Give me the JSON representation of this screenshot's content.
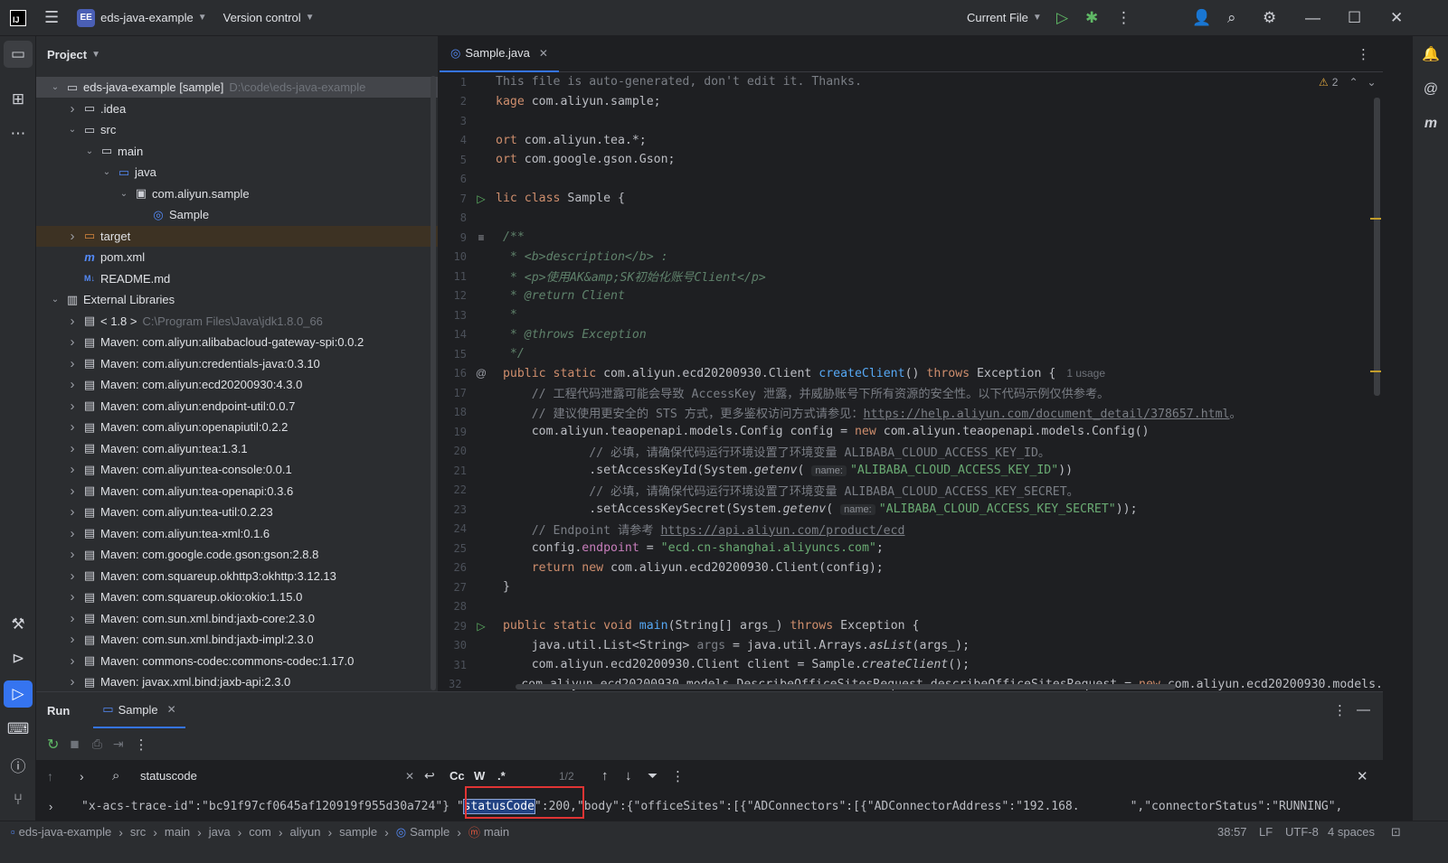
{
  "titlebar": {
    "project_badge": "EE",
    "project_name": "eds-java-example",
    "vcs": "Version control",
    "run_config": "Current File"
  },
  "project_panel": {
    "title": "Project",
    "tree": [
      {
        "indent": 0,
        "arrow": "down",
        "icon": "folder",
        "label": "eds-java-example [sample]",
        "path": "D:\\code\\eds-java-example",
        "selected": true
      },
      {
        "indent": 1,
        "arrow": "right",
        "icon": "folder",
        "label": ".idea"
      },
      {
        "indent": 1,
        "arrow": "down",
        "icon": "folder",
        "label": "src"
      },
      {
        "indent": 2,
        "arrow": "down",
        "icon": "folder",
        "label": "main"
      },
      {
        "indent": 3,
        "arrow": "down",
        "icon": "folder-blue",
        "label": "java"
      },
      {
        "indent": 4,
        "arrow": "down",
        "icon": "package",
        "label": "com.aliyun.sample"
      },
      {
        "indent": 5,
        "arrow": "none",
        "icon": "class",
        "label": "Sample"
      },
      {
        "indent": 1,
        "arrow": "right",
        "icon": "folder-orange",
        "label": "target",
        "highlight": true
      },
      {
        "indent": 1,
        "arrow": "none",
        "icon": "maven",
        "label": "pom.xml"
      },
      {
        "indent": 1,
        "arrow": "none",
        "icon": "markdown",
        "label": "README.md"
      },
      {
        "indent": 0,
        "arrow": "down",
        "icon": "library",
        "label": "External Libraries"
      },
      {
        "indent": 1,
        "arrow": "right",
        "icon": "lib",
        "label": "< 1.8 >",
        "path": "C:\\Program Files\\Java\\jdk1.8.0_66"
      },
      {
        "indent": 1,
        "arrow": "right",
        "icon": "lib",
        "label": "Maven: com.aliyun:alibabacloud-gateway-spi:0.0.2"
      },
      {
        "indent": 1,
        "arrow": "right",
        "icon": "lib",
        "label": "Maven: com.aliyun:credentials-java:0.3.10"
      },
      {
        "indent": 1,
        "arrow": "right",
        "icon": "lib",
        "label": "Maven: com.aliyun:ecd20200930:4.3.0"
      },
      {
        "indent": 1,
        "arrow": "right",
        "icon": "lib",
        "label": "Maven: com.aliyun:endpoint-util:0.0.7"
      },
      {
        "indent": 1,
        "arrow": "right",
        "icon": "lib",
        "label": "Maven: com.aliyun:openapiutil:0.2.2"
      },
      {
        "indent": 1,
        "arrow": "right",
        "icon": "lib",
        "label": "Maven: com.aliyun:tea:1.3.1"
      },
      {
        "indent": 1,
        "arrow": "right",
        "icon": "lib",
        "label": "Maven: com.aliyun:tea-console:0.0.1"
      },
      {
        "indent": 1,
        "arrow": "right",
        "icon": "lib",
        "label": "Maven: com.aliyun:tea-openapi:0.3.6"
      },
      {
        "indent": 1,
        "arrow": "right",
        "icon": "lib",
        "label": "Maven: com.aliyun:tea-util:0.2.23"
      },
      {
        "indent": 1,
        "arrow": "right",
        "icon": "lib",
        "label": "Maven: com.aliyun:tea-xml:0.1.6"
      },
      {
        "indent": 1,
        "arrow": "right",
        "icon": "lib",
        "label": "Maven: com.google.code.gson:gson:2.8.8"
      },
      {
        "indent": 1,
        "arrow": "right",
        "icon": "lib",
        "label": "Maven: com.squareup.okhttp3:okhttp:3.12.13"
      },
      {
        "indent": 1,
        "arrow": "right",
        "icon": "lib",
        "label": "Maven: com.squareup.okio:okio:1.15.0"
      },
      {
        "indent": 1,
        "arrow": "right",
        "icon": "lib",
        "label": "Maven: com.sun.xml.bind:jaxb-core:2.3.0"
      },
      {
        "indent": 1,
        "arrow": "right",
        "icon": "lib",
        "label": "Maven: com.sun.xml.bind:jaxb-impl:2.3.0"
      },
      {
        "indent": 1,
        "arrow": "right",
        "icon": "lib",
        "label": "Maven: commons-codec:commons-codec:1.17.0"
      },
      {
        "indent": 1,
        "arrow": "right",
        "icon": "lib",
        "label": "Maven: javax.xml.bind:jaxb-api:2.3.0"
      }
    ]
  },
  "editor": {
    "tab_label": "Sample.java",
    "warnings": "2",
    "lines": [
      {
        "n": "1",
        "g": "",
        "seg": [
          [
            "c",
            "This file is auto-generated, don't edit it. Thanks."
          ]
        ]
      },
      {
        "n": "2",
        "g": "",
        "seg": [
          [
            "k",
            "kage "
          ],
          [
            "",
            "com.aliyun.sample;"
          ]
        ]
      },
      {
        "n": "3",
        "g": "",
        "seg": []
      },
      {
        "n": "4",
        "g": "",
        "seg": [
          [
            "k",
            "ort "
          ],
          [
            "",
            "com.aliyun.tea.*;"
          ]
        ]
      },
      {
        "n": "5",
        "g": "",
        "seg": [
          [
            "k",
            "ort "
          ],
          [
            "",
            "com.google.gson.Gson;"
          ]
        ]
      },
      {
        "n": "6",
        "g": "",
        "seg": []
      },
      {
        "n": "7",
        "g": "run",
        "seg": [
          [
            "k",
            "lic class "
          ],
          [
            "",
            "Sample {"
          ]
        ]
      },
      {
        "n": "8",
        "g": "",
        "seg": []
      },
      {
        "n": "9",
        "g": "doc",
        "seg": [
          [
            "d",
            " /**"
          ]
        ]
      },
      {
        "n": "10",
        "g": "",
        "seg": [
          [
            "d",
            "  * <b>description</b> :"
          ]
        ]
      },
      {
        "n": "11",
        "g": "",
        "seg": [
          [
            "d",
            "  * <p>使用AK&amp;SK初始化账号Client</p>"
          ]
        ]
      },
      {
        "n": "12",
        "g": "",
        "seg": [
          [
            "d",
            "  * @return Client"
          ]
        ]
      },
      {
        "n": "13",
        "g": "",
        "seg": [
          [
            "d",
            "  *"
          ]
        ]
      },
      {
        "n": "14",
        "g": "",
        "seg": [
          [
            "d",
            "  * @throws Exception"
          ]
        ]
      },
      {
        "n": "15",
        "g": "",
        "seg": [
          [
            "d",
            "  */"
          ]
        ]
      },
      {
        "n": "16",
        "g": "at",
        "seg": [
          [
            "k",
            " public static "
          ],
          [
            "",
            "com.aliyun.ecd20200930.Client "
          ],
          [
            "f",
            "createClient"
          ],
          [
            "",
            "() "
          ],
          [
            "k",
            "throws "
          ],
          [
            "",
            "Exception {"
          ],
          [
            "usage",
            "1 usage"
          ]
        ]
      },
      {
        "n": "17",
        "g": "",
        "seg": [
          [
            "c",
            "     // 工程代码泄露可能会导致 AccessKey 泄露，并威胁账号下所有资源的安全性。以下代码示例仅供参考。"
          ]
        ]
      },
      {
        "n": "18",
        "g": "",
        "seg": [
          [
            "c",
            "     // 建议使用更安全的 STS 方式，更多鉴权访问方式请参见："
          ],
          [
            "u",
            "https://help.aliyun.com/document_detail/378657.html"
          ],
          [
            "c",
            "。"
          ]
        ]
      },
      {
        "n": "19",
        "g": "",
        "seg": [
          [
            "",
            "     com.aliyun.teaopenapi.models.Config config = "
          ],
          [
            "k",
            "new "
          ],
          [
            "",
            "com.aliyun.teaopenapi.models.Config()"
          ]
        ]
      },
      {
        "n": "20",
        "g": "",
        "seg": [
          [
            "c",
            "             // 必填，请确保代码运行环境设置了环境变量 ALIBABA_CLOUD_ACCESS_KEY_ID。"
          ]
        ]
      },
      {
        "n": "21",
        "g": "",
        "seg": [
          [
            "",
            "             .setAccessKeyId(System."
          ],
          [
            "it",
            "getenv"
          ],
          [
            "",
            "( "
          ],
          [
            "hint",
            "name:"
          ],
          [
            "s",
            "\"ALIBABA_CLOUD_ACCESS_KEY_ID\""
          ],
          [
            "",
            "))"
          ]
        ]
      },
      {
        "n": "22",
        "g": "",
        "seg": [
          [
            "c",
            "             // 必填，请确保代码运行环境设置了环境变量 ALIBABA_CLOUD_ACCESS_KEY_SECRET。"
          ]
        ]
      },
      {
        "n": "23",
        "g": "",
        "seg": [
          [
            "",
            "             .setAccessKeySecret(System."
          ],
          [
            "it",
            "getenv"
          ],
          [
            "",
            "( "
          ],
          [
            "hint",
            "name:"
          ],
          [
            "s",
            "\"ALIBABA_CLOUD_ACCESS_KEY_SECRET\""
          ],
          [
            "",
            "));"
          ]
        ]
      },
      {
        "n": "24",
        "g": "",
        "seg": [
          [
            "c",
            "     // Endpoint 请参考 "
          ],
          [
            "u",
            "https://api.aliyun.com/product/ecd"
          ]
        ]
      },
      {
        "n": "25",
        "g": "",
        "seg": [
          [
            "",
            "     config."
          ],
          [
            "fld",
            "endpoint"
          ],
          [
            "",
            " = "
          ],
          [
            "s",
            "\"ecd.cn-shanghai.aliyuncs.com\""
          ],
          [
            "",
            ";"
          ]
        ]
      },
      {
        "n": "26",
        "g": "",
        "seg": [
          [
            "k",
            "     return new "
          ],
          [
            "",
            "com.aliyun.ecd20200930.Client(config);"
          ]
        ]
      },
      {
        "n": "27",
        "g": "",
        "seg": [
          [
            "",
            " }"
          ]
        ]
      },
      {
        "n": "28",
        "g": "",
        "seg": []
      },
      {
        "n": "29",
        "g": "run",
        "seg": [
          [
            "k",
            " public static void "
          ],
          [
            "f",
            "main"
          ],
          [
            "",
            "(String[] args_) "
          ],
          [
            "k",
            "throws "
          ],
          [
            "",
            "Exception {"
          ]
        ]
      },
      {
        "n": "30",
        "g": "",
        "seg": [
          [
            "",
            "     java.util.List<String> "
          ],
          [
            "c",
            "args"
          ],
          [
            "",
            " = java.util.Arrays."
          ],
          [
            "it",
            "asList"
          ],
          [
            "",
            "(args_);"
          ]
        ]
      },
      {
        "n": "31",
        "g": "",
        "seg": [
          [
            "",
            "     com.aliyun.ecd20200930.Client client = Sample."
          ],
          [
            "it",
            "createClient"
          ],
          [
            "",
            "();"
          ]
        ]
      },
      {
        "n": "32",
        "g": "",
        "seg": [
          [
            "",
            "     com.aliyun.ecd20200930.models.DescribeOfficeSitesRequest describeOfficeSitesRequest = "
          ],
          [
            "k",
            "new "
          ],
          [
            "",
            "com.aliyun.ecd20200930.models."
          ]
        ]
      }
    ]
  },
  "run_panel": {
    "title": "Run",
    "tab_label": "Sample",
    "search_query": "statuscode",
    "match_case": "Cc",
    "words": "W",
    "regex": ".*",
    "match_count": "1/2",
    "output_prefix": "\"x-acs-trace-id\":\"bc91f97cf0645af120919f955d30a724\"} \"",
    "output_match": "statusCode",
    "output_after": "\":200,\"body\":{\"officeSites\":[{\"ADConnectors\":[{\"ADConnectorAddress\":\"192.168.",
    "output_tail": "\",\"connectorStatus\":\"RUNNING\","
  },
  "statusbar": {
    "breadcrumbs": [
      "eds-java-example",
      "src",
      "main",
      "java",
      "com",
      "aliyun",
      "sample",
      "Sample",
      "main"
    ],
    "position": "38:57",
    "line_sep": "LF",
    "encoding": "UTF-8",
    "indent": "4 spaces"
  }
}
